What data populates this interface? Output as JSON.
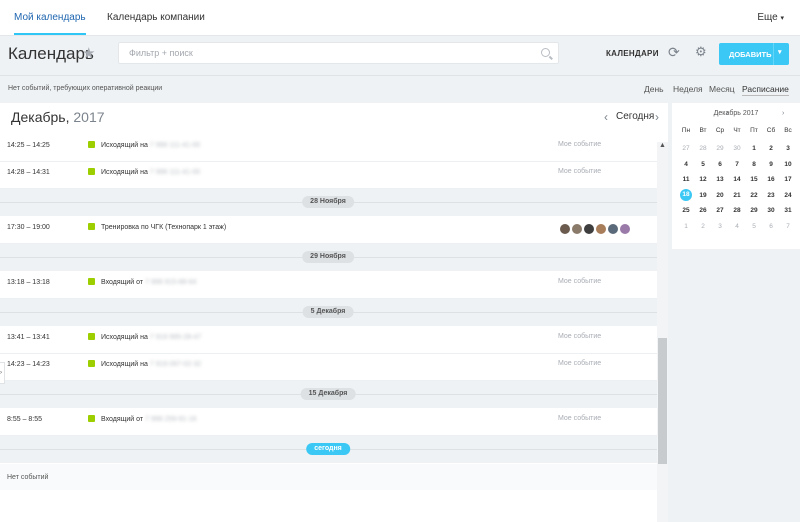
{
  "topbar": {
    "tabs": [
      {
        "label": "Мой календарь",
        "active": true
      },
      {
        "label": "Календарь компании",
        "active": false
      }
    ],
    "more_label": "Еще"
  },
  "header": {
    "title": "Календарь",
    "search_placeholder": "Фильтр + поиск",
    "calendars_label": "КАЛЕНДАРИ",
    "add_label": "ДОБАВИТЬ"
  },
  "subheader": {
    "no_urgent": "Нет событий, требующих оперативной реакции",
    "views": [
      {
        "label": "День",
        "active": false
      },
      {
        "label": "Неделя",
        "active": false
      },
      {
        "label": "Месяц",
        "active": false
      },
      {
        "label": "Расписание",
        "active": true
      }
    ]
  },
  "main": {
    "month": "Декабрь,",
    "year": "2017",
    "today_label": "Сегодня",
    "no_events": "Нет событий",
    "mine_label": "Мое событие"
  },
  "events": [
    {
      "type": "row",
      "time": "14:25 – 14:25",
      "title": "Исходящий на",
      "phone": "7 999 111-41-00",
      "mine": true
    },
    {
      "type": "row",
      "time": "14:28 – 14:31",
      "title": "Исходящий на",
      "phone": "7 999 111-41-00",
      "mine": true
    },
    {
      "type": "divider",
      "label": "28 Ноября"
    },
    {
      "type": "row",
      "time": "17:30 – 19:00",
      "title": "Тренировка по ЧГК (Технопарк 1 этаж)",
      "phone": "",
      "mine": false,
      "attendees": 6
    },
    {
      "type": "divider",
      "label": "29 Ноября"
    },
    {
      "type": "row",
      "time": "13:18 – 13:18",
      "title": "Входящий от",
      "phone": "7 999 915-88-64",
      "mine": true
    },
    {
      "type": "divider",
      "label": "5 Декабря"
    },
    {
      "type": "row",
      "time": "13:41 – 13:41",
      "title": "Исходящий на",
      "phone": "7 919 995-28-47",
      "mine": true
    },
    {
      "type": "row",
      "time": "14:23 – 14:23",
      "title": "Исходящий на",
      "phone": "7 919 097-02-32",
      "mine": true
    },
    {
      "type": "divider",
      "label": "15 Декабря"
    },
    {
      "type": "row",
      "time": "8:55 – 8:55",
      "title": "Входящий от",
      "phone": "7 999 259-91-16",
      "mine": true
    },
    {
      "type": "today",
      "label": "сегодня"
    },
    {
      "type": "empty"
    }
  ],
  "minical": {
    "title": "Декабрь 2017",
    "dow": [
      "Пн",
      "Вт",
      "Ср",
      "Чт",
      "Пт",
      "Сб",
      "Вс"
    ],
    "weeks": [
      [
        [
          "27",
          1
        ],
        [
          "28",
          1
        ],
        [
          "29",
          1
        ],
        [
          "30",
          1
        ],
        [
          "1",
          0
        ],
        [
          "2",
          0
        ],
        [
          "3",
          0
        ]
      ],
      [
        [
          "4",
          0
        ],
        [
          "5",
          0
        ],
        [
          "6",
          0
        ],
        [
          "7",
          0
        ],
        [
          "8",
          0
        ],
        [
          "9",
          0
        ],
        [
          "10",
          0
        ]
      ],
      [
        [
          "11",
          0
        ],
        [
          "12",
          0
        ],
        [
          "13",
          0
        ],
        [
          "14",
          0
        ],
        [
          "15",
          0
        ],
        [
          "16",
          0
        ],
        [
          "17",
          0
        ]
      ],
      [
        [
          "18",
          2
        ],
        [
          "19",
          0
        ],
        [
          "20",
          0
        ],
        [
          "21",
          0
        ],
        [
          "22",
          0
        ],
        [
          "23",
          0
        ],
        [
          "24",
          0
        ]
      ],
      [
        [
          "25",
          0
        ],
        [
          "26",
          0
        ],
        [
          "27",
          0
        ],
        [
          "28",
          0
        ],
        [
          "29",
          0
        ],
        [
          "30",
          0
        ],
        [
          "31",
          0
        ]
      ],
      [
        [
          "1",
          1
        ],
        [
          "2",
          1
        ],
        [
          "3",
          1
        ],
        [
          "4",
          1
        ],
        [
          "5",
          1
        ],
        [
          "6",
          1
        ],
        [
          "7",
          1
        ]
      ]
    ]
  },
  "colors": {
    "accent": "#3bc8f5",
    "event_dot": "#9dcf00",
    "link": "#2067b0",
    "avatars": [
      "#6b5b4e",
      "#8a7a6a",
      "#3e3e3e",
      "#a87d5a",
      "#5a6a7a",
      "#9a7aa8"
    ]
  }
}
